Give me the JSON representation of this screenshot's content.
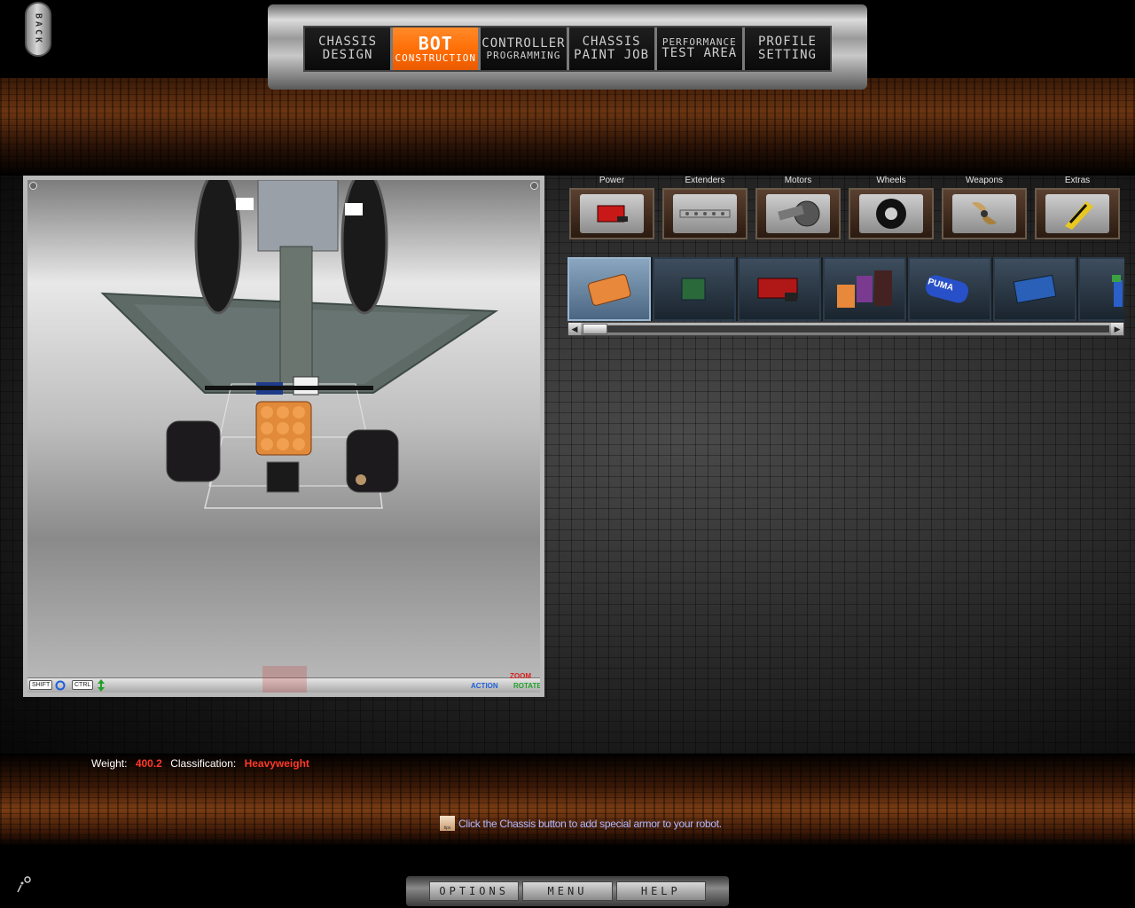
{
  "back": {
    "label": "BACK"
  },
  "nav": {
    "tabs": [
      {
        "line1": "CHASSIS",
        "line2": "DESIGN",
        "active": false
      },
      {
        "line1": "BOT",
        "line2": "CONSTRUCTION",
        "active": true
      },
      {
        "line1": "CONTROLLER",
        "line2": "PROGRAMMING",
        "active": false
      },
      {
        "line1": "CHASSIS",
        "line2": "PAINT JOB",
        "active": false
      },
      {
        "line1": "PERFORMANCE",
        "line2": "TEST AREA",
        "active": false
      },
      {
        "line1": "PROFILE",
        "line2": "SETTING",
        "active": false
      }
    ]
  },
  "viewport": {
    "shift_key": "SHIFT",
    "ctrl_key": "CTRL",
    "action_label": "ACTION",
    "zoom_label": "ZOOM",
    "rotate_label": "ROTATE"
  },
  "categories": [
    {
      "label": "Power",
      "icon": "battery-icon"
    },
    {
      "label": "Extenders",
      "icon": "extender-bar-icon"
    },
    {
      "label": "Motors",
      "icon": "motor-icon"
    },
    {
      "label": "Wheels",
      "icon": "wheel-icon"
    },
    {
      "label": "Weapons",
      "icon": "blade-icon"
    },
    {
      "label": "Extras",
      "icon": "extras-icon"
    }
  ],
  "parts": [
    {
      "icon": "battery-pack-icon",
      "selected": true
    },
    {
      "icon": "circuit-board-icon",
      "selected": false
    },
    {
      "icon": "red-battery-icon",
      "selected": false
    },
    {
      "icon": "battery-cluster-icon",
      "selected": false
    },
    {
      "icon": "puma-battery-icon",
      "label": "PUMA",
      "selected": false
    },
    {
      "icon": "blue-battery-icon",
      "selected": false
    },
    {
      "icon": "partial-part-icon",
      "selected": false
    }
  ],
  "stats": {
    "weight_label": "Weight:",
    "weight_value": "400.2",
    "class_label": "Classification:",
    "class_value": "Heavyweight"
  },
  "tip": {
    "icon_label": "tips",
    "text": "Click the Chassis button to add special armor to your robot."
  },
  "bottom_menu": {
    "options": "OPTIONS",
    "menu": "MENU",
    "help": "HELP"
  },
  "colors": {
    "active_tab": "#ff6a00",
    "value_red": "#ff3a2a",
    "tip_text": "#b0b8ff"
  }
}
